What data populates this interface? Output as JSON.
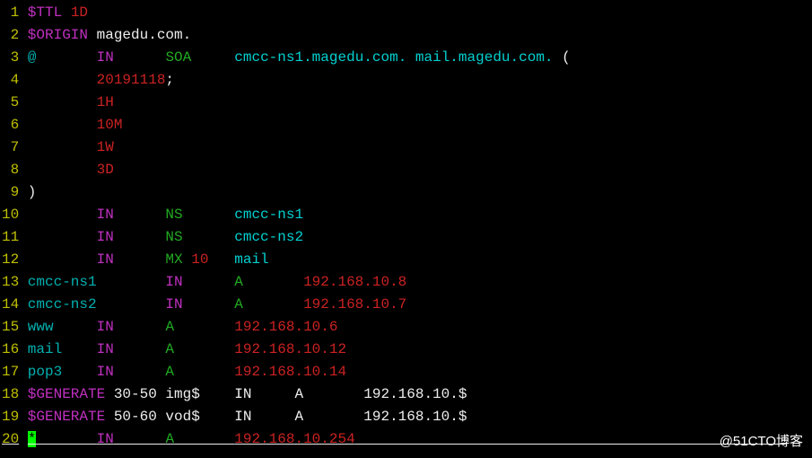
{
  "watermark": "@51CTO博客",
  "lines": [
    {
      "n": "1",
      "spans": [
        {
          "cls": "magenta",
          "t": "$TTL "
        },
        {
          "cls": "red",
          "t": "1D"
        }
      ]
    },
    {
      "n": "2",
      "spans": [
        {
          "cls": "magenta",
          "t": "$ORIGIN"
        },
        {
          "cls": "white",
          "t": " magedu.com."
        }
      ]
    },
    {
      "n": "3",
      "spans": [
        {
          "cls": "cyan",
          "t": "@"
        },
        {
          "cls": "white",
          "t": "       "
        },
        {
          "cls": "magenta",
          "t": "IN"
        },
        {
          "cls": "white",
          "t": "      "
        },
        {
          "cls": "green",
          "t": "SOA"
        },
        {
          "cls": "white",
          "t": "     "
        },
        {
          "cls": "brightcyan",
          "t": "cmcc-ns1.magedu.com. mail.magedu.com."
        },
        {
          "cls": "white",
          "t": " ("
        }
      ]
    },
    {
      "n": "4",
      "spans": [
        {
          "cls": "white",
          "t": "        "
        },
        {
          "cls": "red",
          "t": "20191118"
        },
        {
          "cls": "white",
          "t": ";"
        }
      ]
    },
    {
      "n": "5",
      "spans": [
        {
          "cls": "white",
          "t": "        "
        },
        {
          "cls": "red",
          "t": "1H"
        }
      ]
    },
    {
      "n": "6",
      "spans": [
        {
          "cls": "white",
          "t": "        "
        },
        {
          "cls": "red",
          "t": "10M"
        }
      ]
    },
    {
      "n": "7",
      "spans": [
        {
          "cls": "white",
          "t": "        "
        },
        {
          "cls": "red",
          "t": "1W"
        }
      ]
    },
    {
      "n": "8",
      "spans": [
        {
          "cls": "white",
          "t": "        "
        },
        {
          "cls": "red",
          "t": "3D"
        }
      ]
    },
    {
      "n": "9",
      "spans": [
        {
          "cls": "white",
          "t": ")"
        }
      ]
    },
    {
      "n": "10",
      "spans": [
        {
          "cls": "white",
          "t": "        "
        },
        {
          "cls": "magenta",
          "t": "IN"
        },
        {
          "cls": "white",
          "t": "      "
        },
        {
          "cls": "green",
          "t": "NS"
        },
        {
          "cls": "white",
          "t": "      "
        },
        {
          "cls": "brightcyan",
          "t": "cmcc-ns1"
        }
      ]
    },
    {
      "n": "11",
      "spans": [
        {
          "cls": "white",
          "t": "        "
        },
        {
          "cls": "magenta",
          "t": "IN"
        },
        {
          "cls": "white",
          "t": "      "
        },
        {
          "cls": "green",
          "t": "NS"
        },
        {
          "cls": "white",
          "t": "      "
        },
        {
          "cls": "brightcyan",
          "t": "cmcc-ns2"
        }
      ]
    },
    {
      "n": "12",
      "spans": [
        {
          "cls": "white",
          "t": "        "
        },
        {
          "cls": "magenta",
          "t": "IN"
        },
        {
          "cls": "white",
          "t": "      "
        },
        {
          "cls": "green",
          "t": "MX"
        },
        {
          "cls": "white",
          "t": " "
        },
        {
          "cls": "red",
          "t": "10"
        },
        {
          "cls": "white",
          "t": "   "
        },
        {
          "cls": "brightcyan",
          "t": "mail"
        }
      ]
    },
    {
      "n": "13",
      "spans": [
        {
          "cls": "cyan",
          "t": "cmcc-ns1"
        },
        {
          "cls": "white",
          "t": "        "
        },
        {
          "cls": "magenta",
          "t": "IN"
        },
        {
          "cls": "white",
          "t": "      "
        },
        {
          "cls": "green",
          "t": "A"
        },
        {
          "cls": "white",
          "t": "       "
        },
        {
          "cls": "red",
          "t": "192.168.10.8"
        }
      ]
    },
    {
      "n": "14",
      "spans": [
        {
          "cls": "cyan",
          "t": "cmcc-ns2"
        },
        {
          "cls": "white",
          "t": "        "
        },
        {
          "cls": "magenta",
          "t": "IN"
        },
        {
          "cls": "white",
          "t": "      "
        },
        {
          "cls": "green",
          "t": "A"
        },
        {
          "cls": "white",
          "t": "       "
        },
        {
          "cls": "red",
          "t": "192.168.10.7"
        }
      ]
    },
    {
      "n": "15",
      "spans": [
        {
          "cls": "cyan",
          "t": "www"
        },
        {
          "cls": "white",
          "t": "     "
        },
        {
          "cls": "magenta",
          "t": "IN"
        },
        {
          "cls": "white",
          "t": "      "
        },
        {
          "cls": "green",
          "t": "A"
        },
        {
          "cls": "white",
          "t": "       "
        },
        {
          "cls": "red",
          "t": "192.168.10.6"
        }
      ]
    },
    {
      "n": "16",
      "spans": [
        {
          "cls": "cyan",
          "t": "mail"
        },
        {
          "cls": "white",
          "t": "    "
        },
        {
          "cls": "magenta",
          "t": "IN"
        },
        {
          "cls": "white",
          "t": "      "
        },
        {
          "cls": "green",
          "t": "A"
        },
        {
          "cls": "white",
          "t": "       "
        },
        {
          "cls": "red",
          "t": "192.168.10.12"
        }
      ]
    },
    {
      "n": "17",
      "spans": [
        {
          "cls": "cyan",
          "t": "pop3"
        },
        {
          "cls": "white",
          "t": "    "
        },
        {
          "cls": "magenta",
          "t": "IN"
        },
        {
          "cls": "white",
          "t": "      "
        },
        {
          "cls": "green",
          "t": "A"
        },
        {
          "cls": "white",
          "t": "       "
        },
        {
          "cls": "red",
          "t": "192.168.10.14"
        }
      ]
    },
    {
      "n": "18",
      "spans": [
        {
          "cls": "magenta",
          "t": "$GENERATE"
        },
        {
          "cls": "white",
          "t": " 30-50 img$    IN     A       192.168.10.$"
        }
      ]
    },
    {
      "n": "19",
      "spans": [
        {
          "cls": "magenta",
          "t": "$GENERATE"
        },
        {
          "cls": "white",
          "t": " 50-60 vod$    IN     A       192.168.10.$"
        }
      ]
    },
    {
      "n": "20",
      "underline": true,
      "spans": [
        {
          "cls": "sel",
          "t": "*"
        },
        {
          "cls": "cyan",
          "t": "       "
        },
        {
          "cls": "magenta",
          "t": "IN"
        },
        {
          "cls": "white",
          "t": "      "
        },
        {
          "cls": "green",
          "t": "A"
        },
        {
          "cls": "white",
          "t": "       "
        },
        {
          "cls": "red",
          "t": "192.168.10.254"
        },
        {
          "cls": "white",
          "t": "                                                  "
        }
      ]
    }
  ]
}
